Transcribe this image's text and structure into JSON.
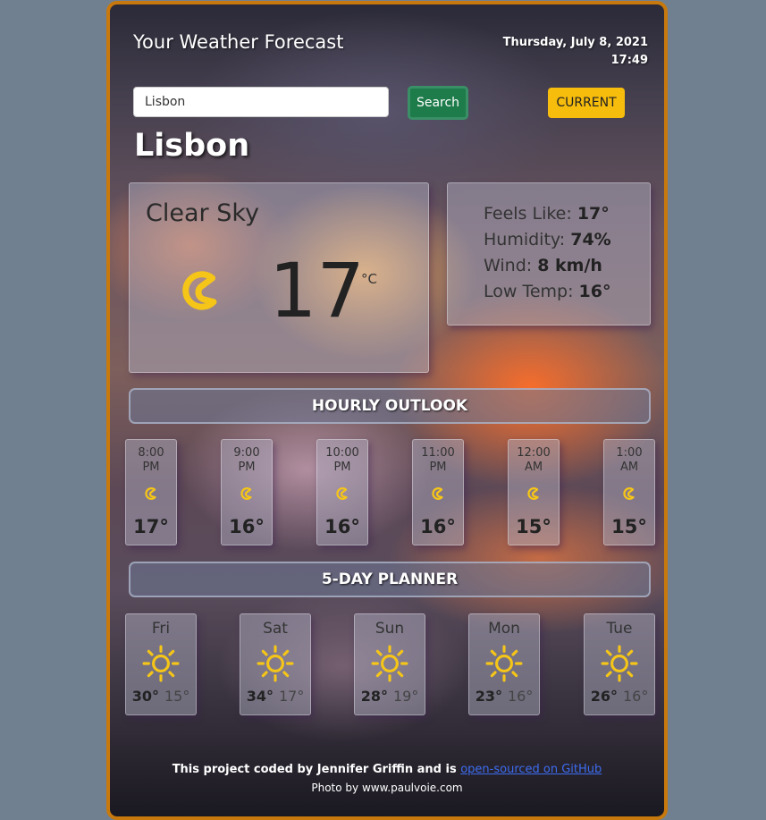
{
  "header": {
    "title": "Your Weather Forecast",
    "date": "Thursday, July 8, 2021",
    "time": "17:49"
  },
  "search": {
    "value": "Lisbon",
    "button_label": "Search",
    "current_label": "CURRENT"
  },
  "city": "Lisbon",
  "current": {
    "condition": "Clear Sky",
    "temp": "17",
    "unit": "°C",
    "icon": "moon-icon",
    "feels_like_label": "Feels Like:",
    "feels_like": "17°",
    "humidity_label": "Humidity:",
    "humidity": "74%",
    "wind_label": "Wind:",
    "wind": "8 km/h",
    "low_label": "Low Temp:",
    "low": "16°"
  },
  "hourly": {
    "title": "HOURLY OUTLOOK",
    "items": [
      {
        "time": "8:00",
        "ampm": "PM",
        "temp": "17°",
        "icon": "moon-icon"
      },
      {
        "time": "9:00",
        "ampm": "PM",
        "temp": "16°",
        "icon": "moon-icon"
      },
      {
        "time": "10:00",
        "ampm": "PM",
        "temp": "16°",
        "icon": "moon-icon"
      },
      {
        "time": "11:00",
        "ampm": "PM",
        "temp": "16°",
        "icon": "moon-icon"
      },
      {
        "time": "12:00",
        "ampm": "AM",
        "temp": "15°",
        "icon": "moon-icon"
      },
      {
        "time": "1:00",
        "ampm": "AM",
        "temp": "15°",
        "icon": "moon-icon"
      }
    ]
  },
  "daily": {
    "title": "5-DAY PLANNER",
    "items": [
      {
        "day": "Fri",
        "hi": "30°",
        "lo": "15°",
        "icon": "sun-icon"
      },
      {
        "day": "Sat",
        "hi": "34°",
        "lo": "17°",
        "icon": "sun-icon"
      },
      {
        "day": "Sun",
        "hi": "28°",
        "lo": "19°",
        "icon": "sun-icon"
      },
      {
        "day": "Mon",
        "hi": "23°",
        "lo": "16°",
        "icon": "sun-icon"
      },
      {
        "day": "Tue",
        "hi": "26°",
        "lo": "16°",
        "icon": "sun-icon"
      }
    ]
  },
  "footer": {
    "credit": "This project coded by Jennifer Griffin and is ",
    "link": "open-sourced on GitHub",
    "photo": "Photo by www.paulvoie.com"
  },
  "colors": {
    "page_bg": "#708090",
    "frame": "#c8790e",
    "search_button": "#1e7b4a",
    "current_button": "#f7bd0c",
    "icon_yellow": "#f5c518",
    "link": "#3d6cf0"
  }
}
